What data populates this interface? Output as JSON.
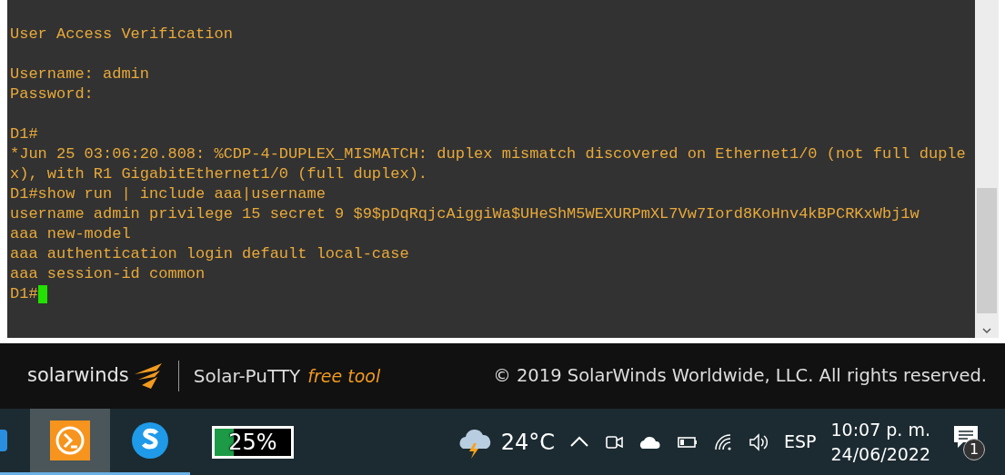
{
  "terminal": {
    "blocks": [
      {
        "lines": [
          {
            "text": "User Access Verification"
          }
        ]
      },
      {
        "lines": [
          {
            "text": "Username: admin"
          },
          {
            "text": "Password:"
          }
        ]
      },
      {
        "lines": [
          {
            "text": "D1#"
          },
          {
            "text": "*Jun 25 03:06:20.808: %CDP-4-DUPLEX_MISMATCH: duplex mismatch discovered on Ethernet1/0 (not full duple"
          },
          {
            "text": "x), with R1 GigabitEthernet1/0 (full duplex)."
          },
          {
            "text": "D1#show run | include aaa|username"
          },
          {
            "text": "username admin privilege 15 secret 9 $9$pDqRqjcAiggiWa$UHeShM5WEXURPmXL7Vw7Iord8KoHnv4kBPCRKxWbj1w"
          },
          {
            "text": "aaa new-model"
          },
          {
            "text": "aaa authentication login default local-case"
          },
          {
            "text": "aaa session-id common"
          },
          {
            "text": "D1#",
            "cursor": true
          }
        ]
      }
    ]
  },
  "banner": {
    "brand": "solarwinds",
    "product": "Solar-PuTTY",
    "tagline": "free tool",
    "copyright": "© 2019 SolarWinds Worldwide, LLC. All rights reserved."
  },
  "taskbar": {
    "apps": [
      {
        "kind": "partial",
        "selected": false
      },
      {
        "kind": "putty",
        "selected": true
      },
      {
        "kind": "skype",
        "selected": false
      }
    ],
    "battery": {
      "level": 0.25,
      "text": "25%"
    },
    "weather": {
      "temperature": "24°C"
    },
    "language": "ESP",
    "time": "10:07 p. m.",
    "date": "24/06/2022",
    "notifications": "1"
  }
}
